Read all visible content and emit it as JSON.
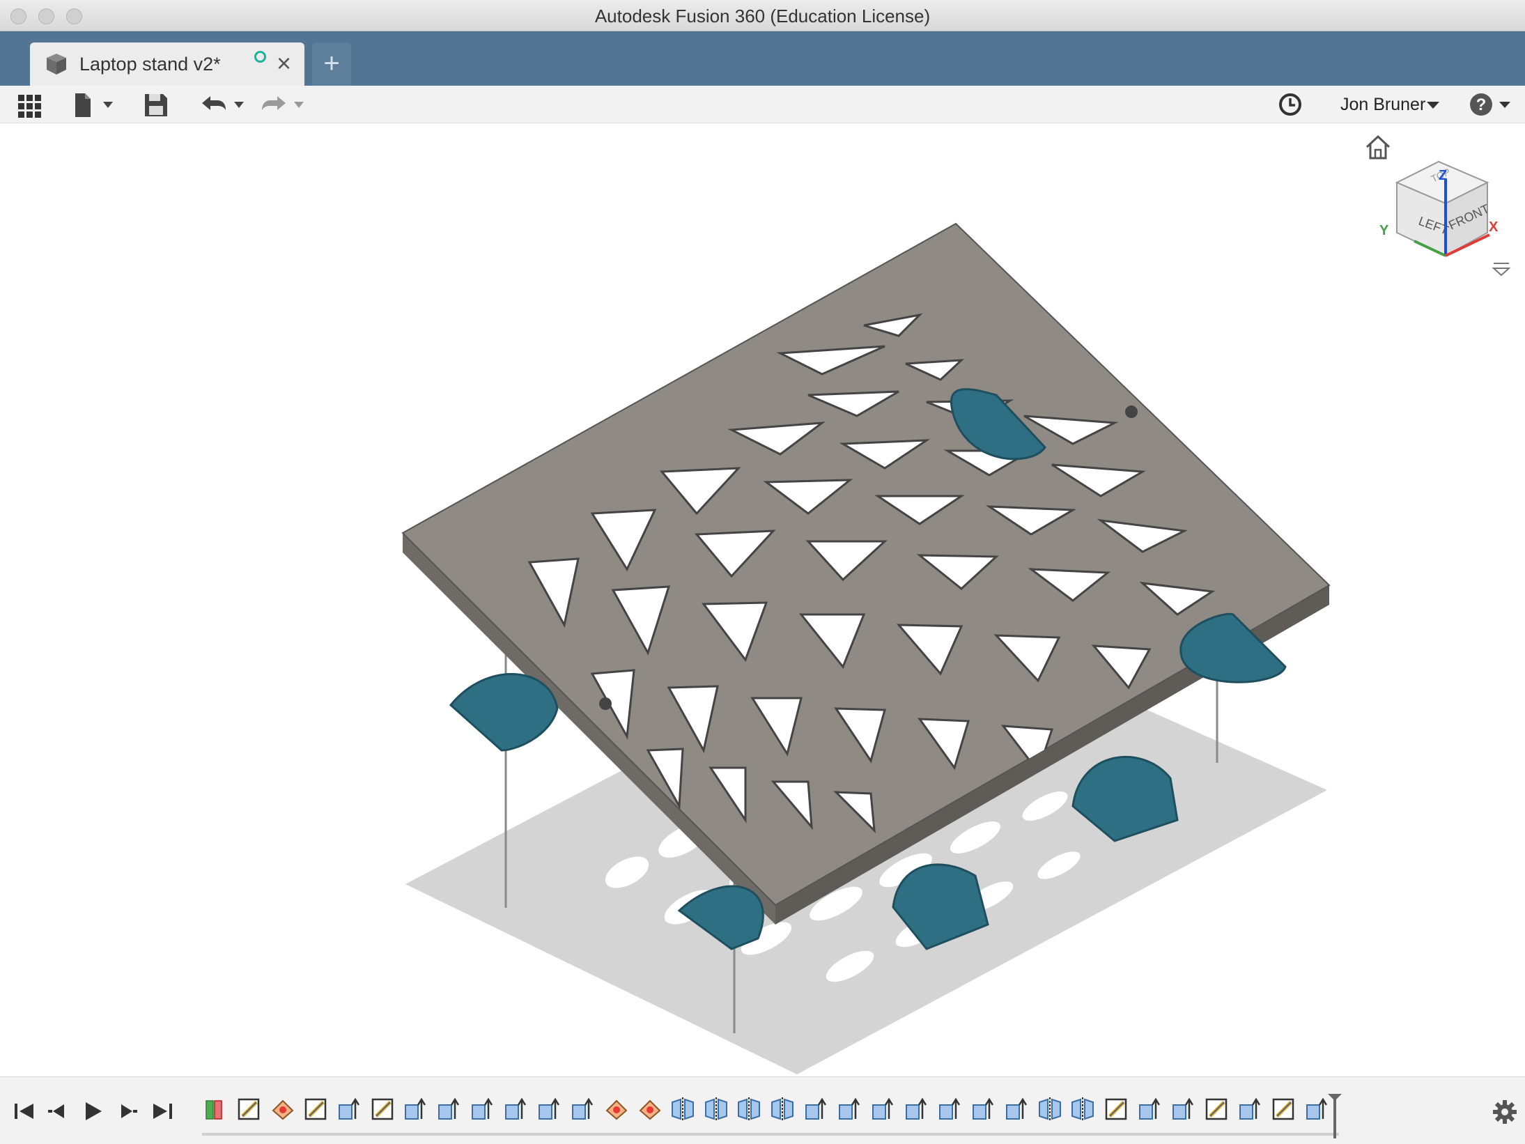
{
  "window": {
    "title": "Autodesk Fusion 360 (Education License)"
  },
  "tabs": [
    {
      "label": "Laptop stand v2*",
      "active": true
    }
  ],
  "toolbar": {
    "user_name": "Jon Bruner",
    "icons": [
      "data-panel-icon",
      "file-menu-icon",
      "save-icon",
      "undo-icon",
      "redo-icon",
      "job-status-icon",
      "help-icon"
    ]
  },
  "viewcube": {
    "faces": [
      "LEFT",
      "FRONT",
      "TOP"
    ],
    "axes": {
      "x": "X",
      "y": "Y",
      "z": "Z"
    },
    "axis_colors": {
      "x": "#e53935",
      "y": "#43a047",
      "z": "#1e4fd8"
    }
  },
  "viewport": {
    "model": "perforated laptop stand plate",
    "colors": {
      "body": "#8f8a84",
      "body_side": "#6e6a65",
      "pads": "#2f6f84",
      "shadow": "#d5d5d5",
      "background": "#ffffff"
    }
  },
  "timeline": {
    "controls": [
      "skip-to-start",
      "step-back",
      "play",
      "step-forward",
      "skip-to-end"
    ],
    "features": [
      "derive",
      "sketch",
      "form",
      "sketch",
      "extrude",
      "sketch",
      "extrude",
      "extrude",
      "extrude",
      "extrude",
      "extrude",
      "extrude",
      "form",
      "form",
      "mirror",
      "mirror",
      "mirror",
      "mirror",
      "extrude",
      "extrude",
      "extrude",
      "extrude",
      "extrude",
      "extrude",
      "extrude",
      "mirror",
      "mirror",
      "sketch",
      "extrude",
      "extrude",
      "sketch",
      "extrude",
      "sketch",
      "extrude"
    ]
  },
  "accent": {
    "tabbar": "#517592",
    "online_status": "#19b39a"
  }
}
